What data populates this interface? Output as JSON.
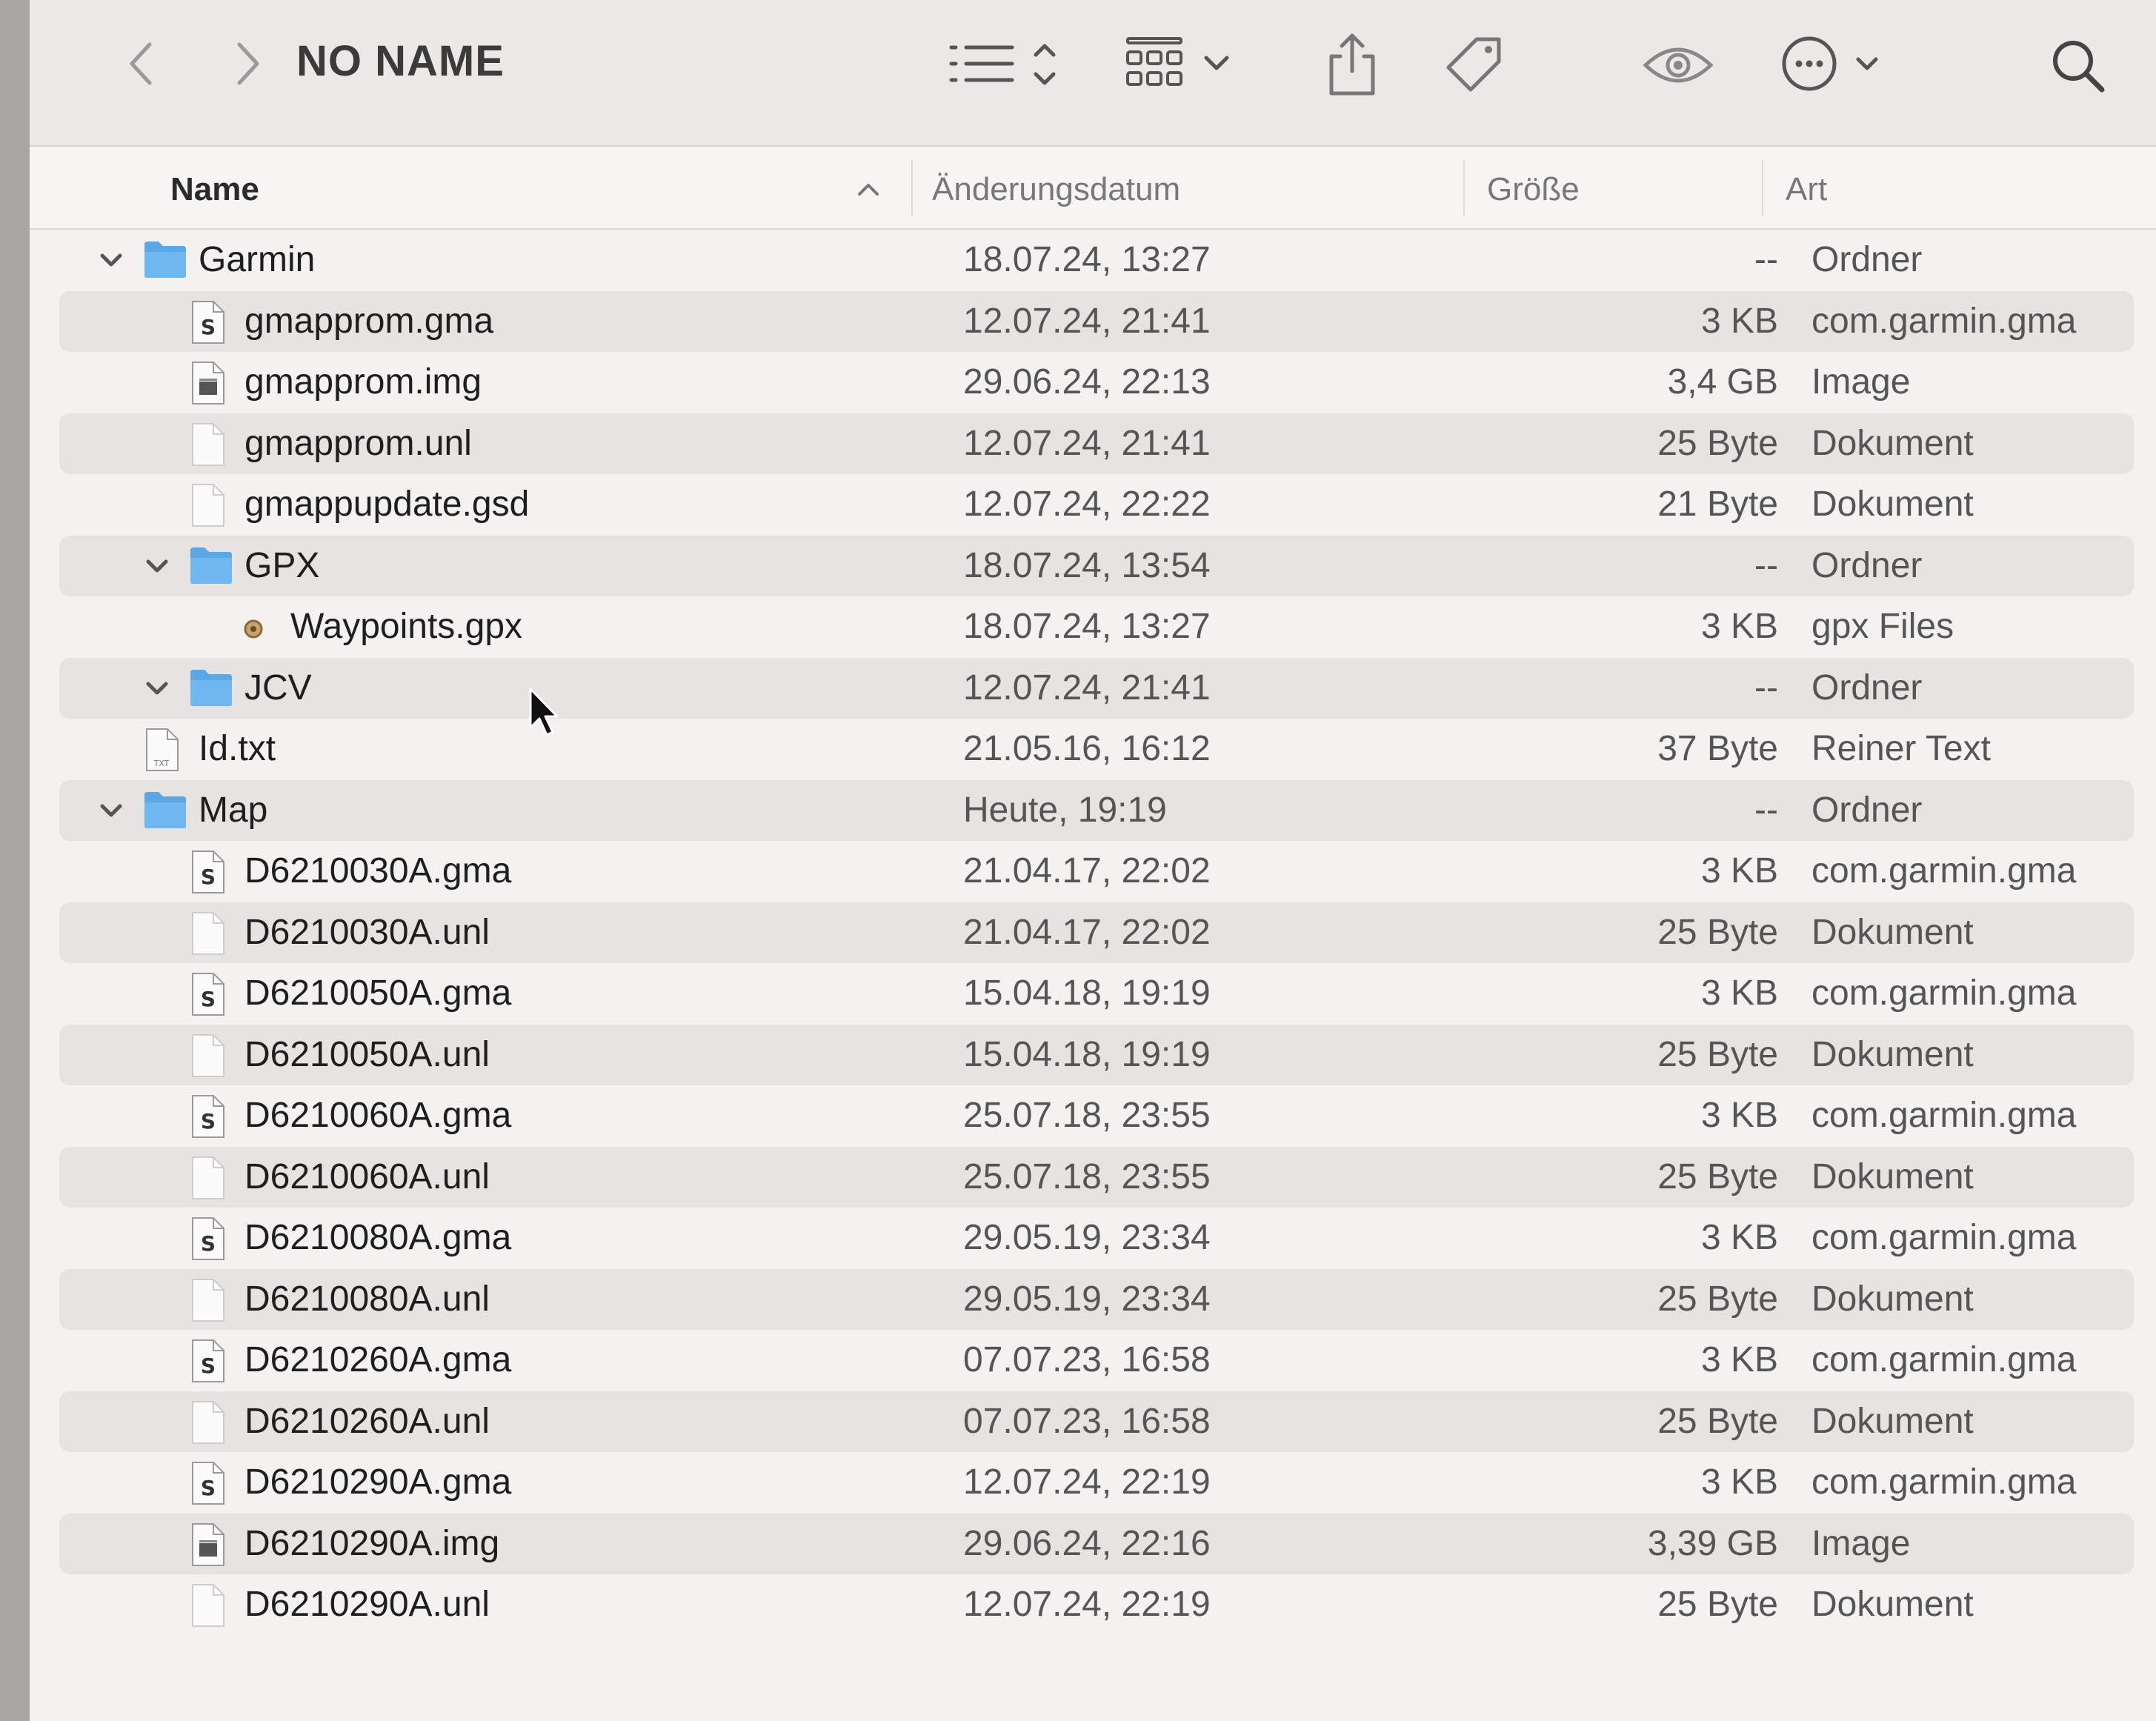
{
  "window": {
    "title": "NO NAME"
  },
  "columns": {
    "name": "Name",
    "date": "Änderungsdatum",
    "size": "Größe",
    "kind": "Art"
  },
  "rows": [
    {
      "name": "Garmin",
      "date": "18.07.24, 13:27",
      "size": "--",
      "kind": "Ordner",
      "icon": "folder-icon",
      "level": 0,
      "expanded": true
    },
    {
      "name": "gmapprom.gma",
      "date": "12.07.24, 21:41",
      "size": "3 KB",
      "kind": "com.garmin.gma",
      "icon": "gma-file-icon",
      "level": 1
    },
    {
      "name": "gmapprom.img",
      "date": "29.06.24, 22:13",
      "size": "3,4 GB",
      "kind": "Image",
      "icon": "image-file-icon",
      "level": 1
    },
    {
      "name": "gmapprom.unl",
      "date": "12.07.24, 21:41",
      "size": "25 Byte",
      "kind": "Dokument",
      "icon": "document-icon",
      "level": 1
    },
    {
      "name": "gmappupdate.gsd",
      "date": "12.07.24, 22:22",
      "size": "21 Byte",
      "kind": "Dokument",
      "icon": "document-icon",
      "level": 1
    },
    {
      "name": "GPX",
      "date": "18.07.24, 13:54",
      "size": "--",
      "kind": "Ordner",
      "icon": "folder-icon",
      "level": 1,
      "expanded": true
    },
    {
      "name": "Waypoints.gpx",
      "date": "18.07.24, 13:27",
      "size": "3 KB",
      "kind": "gpx Files",
      "icon": "gpx-file-icon",
      "level": 2
    },
    {
      "name": "JCV",
      "date": "12.07.24, 21:41",
      "size": "--",
      "kind": "Ordner",
      "icon": "folder-icon",
      "level": 1,
      "expanded": true
    },
    {
      "name": "Id.txt",
      "date": "21.05.16, 16:12",
      "size": "37 Byte",
      "kind": "Reiner Text",
      "icon": "text-file-icon",
      "level": 0
    },
    {
      "name": "Map",
      "date": "Heute, 19:19",
      "size": "--",
      "kind": "Ordner",
      "icon": "folder-icon",
      "level": 0,
      "expanded": true
    },
    {
      "name": "D6210030A.gma",
      "date": "21.04.17, 22:02",
      "size": "3 KB",
      "kind": "com.garmin.gma",
      "icon": "gma-file-icon",
      "level": 1
    },
    {
      "name": "D6210030A.unl",
      "date": "21.04.17, 22:02",
      "size": "25 Byte",
      "kind": "Dokument",
      "icon": "document-icon",
      "level": 1
    },
    {
      "name": "D6210050A.gma",
      "date": "15.04.18, 19:19",
      "size": "3 KB",
      "kind": "com.garmin.gma",
      "icon": "gma-file-icon",
      "level": 1
    },
    {
      "name": "D6210050A.unl",
      "date": "15.04.18, 19:19",
      "size": "25 Byte",
      "kind": "Dokument",
      "icon": "document-icon",
      "level": 1
    },
    {
      "name": "D6210060A.gma",
      "date": "25.07.18, 23:55",
      "size": "3 KB",
      "kind": "com.garmin.gma",
      "icon": "gma-file-icon",
      "level": 1
    },
    {
      "name": "D6210060A.unl",
      "date": "25.07.18, 23:55",
      "size": "25 Byte",
      "kind": "Dokument",
      "icon": "document-icon",
      "level": 1
    },
    {
      "name": "D6210080A.gma",
      "date": "29.05.19, 23:34",
      "size": "3 KB",
      "kind": "com.garmin.gma",
      "icon": "gma-file-icon",
      "level": 1
    },
    {
      "name": "D6210080A.unl",
      "date": "29.05.19, 23:34",
      "size": "25 Byte",
      "kind": "Dokument",
      "icon": "document-icon",
      "level": 1
    },
    {
      "name": "D6210260A.gma",
      "date": "07.07.23, 16:58",
      "size": "3 KB",
      "kind": "com.garmin.gma",
      "icon": "gma-file-icon",
      "level": 1
    },
    {
      "name": "D6210260A.unl",
      "date": "07.07.23, 16:58",
      "size": "25 Byte",
      "kind": "Dokument",
      "icon": "document-icon",
      "level": 1
    },
    {
      "name": "D6210290A.gma",
      "date": "12.07.24, 22:19",
      "size": "3 KB",
      "kind": "com.garmin.gma",
      "icon": "gma-file-icon",
      "level": 1
    },
    {
      "name": "D6210290A.img",
      "date": "29.06.24, 22:16",
      "size": "3,39 GB",
      "kind": "Image",
      "icon": "image-file-icon",
      "level": 1
    },
    {
      "name": "D6210290A.unl",
      "date": "12.07.24, 22:19",
      "size": "25 Byte",
      "kind": "Dokument",
      "icon": "document-icon",
      "level": 1
    }
  ],
  "colors": {
    "folder": "#5aa9e6",
    "alt_row": "#e6e3e1",
    "toolbar": "#ebe8e6"
  }
}
